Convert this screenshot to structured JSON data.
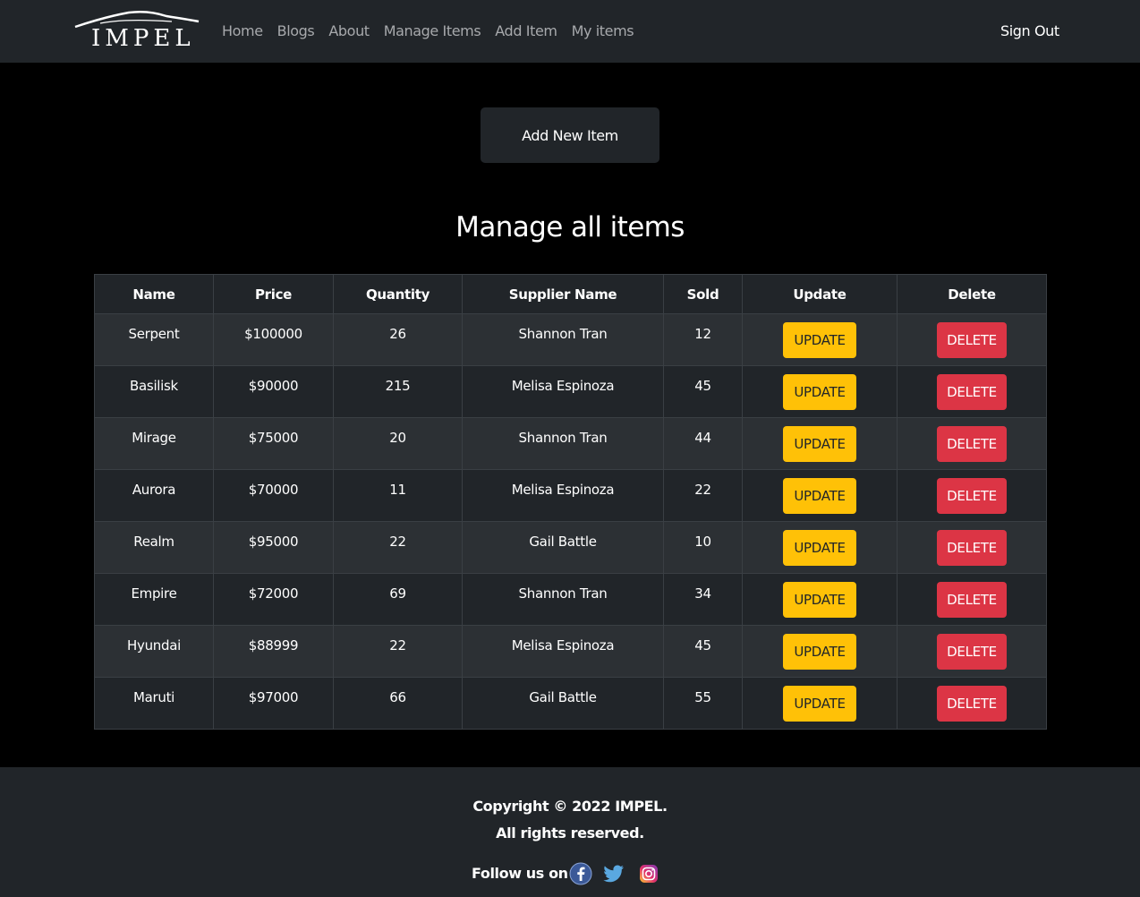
{
  "brand": {
    "logo_text": "IMPEL"
  },
  "nav": {
    "links": [
      "Home",
      "Blogs",
      "About",
      "Manage Items",
      "Add Item",
      "My items"
    ],
    "sign_out": "Sign Out"
  },
  "main": {
    "add_button": "Add New Item",
    "heading": "Manage all items"
  },
  "table": {
    "headers": [
      "Name",
      "Price",
      "Quantity",
      "Supplier Name",
      "Sold",
      "Update",
      "Delete"
    ],
    "update_label": "UPDATE",
    "delete_label": "DELETE",
    "rows": [
      {
        "name": "Serpent",
        "price": "$100000",
        "quantity": "26",
        "supplier": "Shannon Tran",
        "sold": "12"
      },
      {
        "name": "Basilisk",
        "price": "$90000",
        "quantity": "215",
        "supplier": "Melisa Espinoza",
        "sold": "45"
      },
      {
        "name": "Mirage",
        "price": "$75000",
        "quantity": "20",
        "supplier": "Shannon Tran",
        "sold": "44"
      },
      {
        "name": "Aurora",
        "price": "$70000",
        "quantity": "11",
        "supplier": "Melisa Espinoza",
        "sold": "22"
      },
      {
        "name": "Realm",
        "price": "$95000",
        "quantity": "22",
        "supplier": "Gail Battle",
        "sold": "10"
      },
      {
        "name": "Empire",
        "price": "$72000",
        "quantity": "69",
        "supplier": "Shannon Tran",
        "sold": "34"
      },
      {
        "name": "Hyundai",
        "price": "$88999",
        "quantity": "22",
        "supplier": "Melisa Espinoza",
        "sold": "45"
      },
      {
        "name": "Maruti",
        "price": "$97000",
        "quantity": "66",
        "supplier": "Gail Battle",
        "sold": "55"
      }
    ]
  },
  "footer": {
    "copyright": "Copyright © 2022 IMPEL.",
    "rights": "All rights reserved.",
    "follow": "Follow us on",
    "social_icons": [
      "facebook-icon",
      "twitter-icon",
      "instagram-icon"
    ]
  },
  "colors": {
    "navbar_bg": "#212529",
    "page_bg": "#000000",
    "update_button": "#ffc107",
    "delete_button": "#dc3545",
    "row_odd": "#2c3034",
    "row_even": "#212529"
  }
}
